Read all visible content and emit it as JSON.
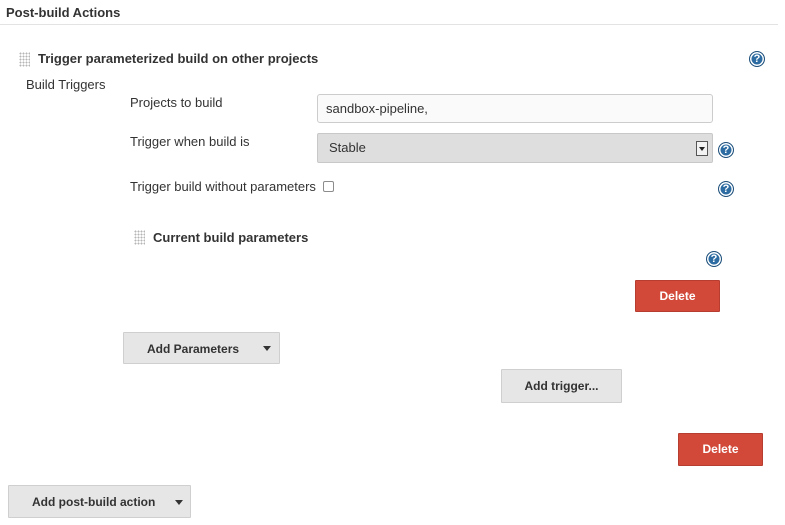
{
  "section": {
    "title": "Post-build Actions"
  },
  "publisher": {
    "title": "Trigger parameterized build on other projects",
    "build_triggers_label": "Build Triggers",
    "fields": {
      "projects_label": "Projects to build",
      "projects_value": "sandbox-pipeline,",
      "trigger_when_label": "Trigger when build is",
      "trigger_when_value": "Stable",
      "without_params_label": "Trigger build without parameters",
      "without_params_checked": false
    },
    "parameter_block": {
      "title": "Current build parameters",
      "delete_label": "Delete"
    },
    "add_parameters_label": "Add Parameters",
    "add_trigger_label": "Add trigger...",
    "delete_label": "Delete"
  },
  "footer": {
    "add_post_build_label": "Add post-build action"
  },
  "icons": {
    "help": "question-mark-help-icon",
    "drag": "drag-handle-icon",
    "dropdown": "chevron-down-icon"
  },
  "colors": {
    "danger": "#d24939",
    "help": "#2d6ca2",
    "button_gray": "#e6e6e6",
    "select_bg": "#dedede"
  }
}
